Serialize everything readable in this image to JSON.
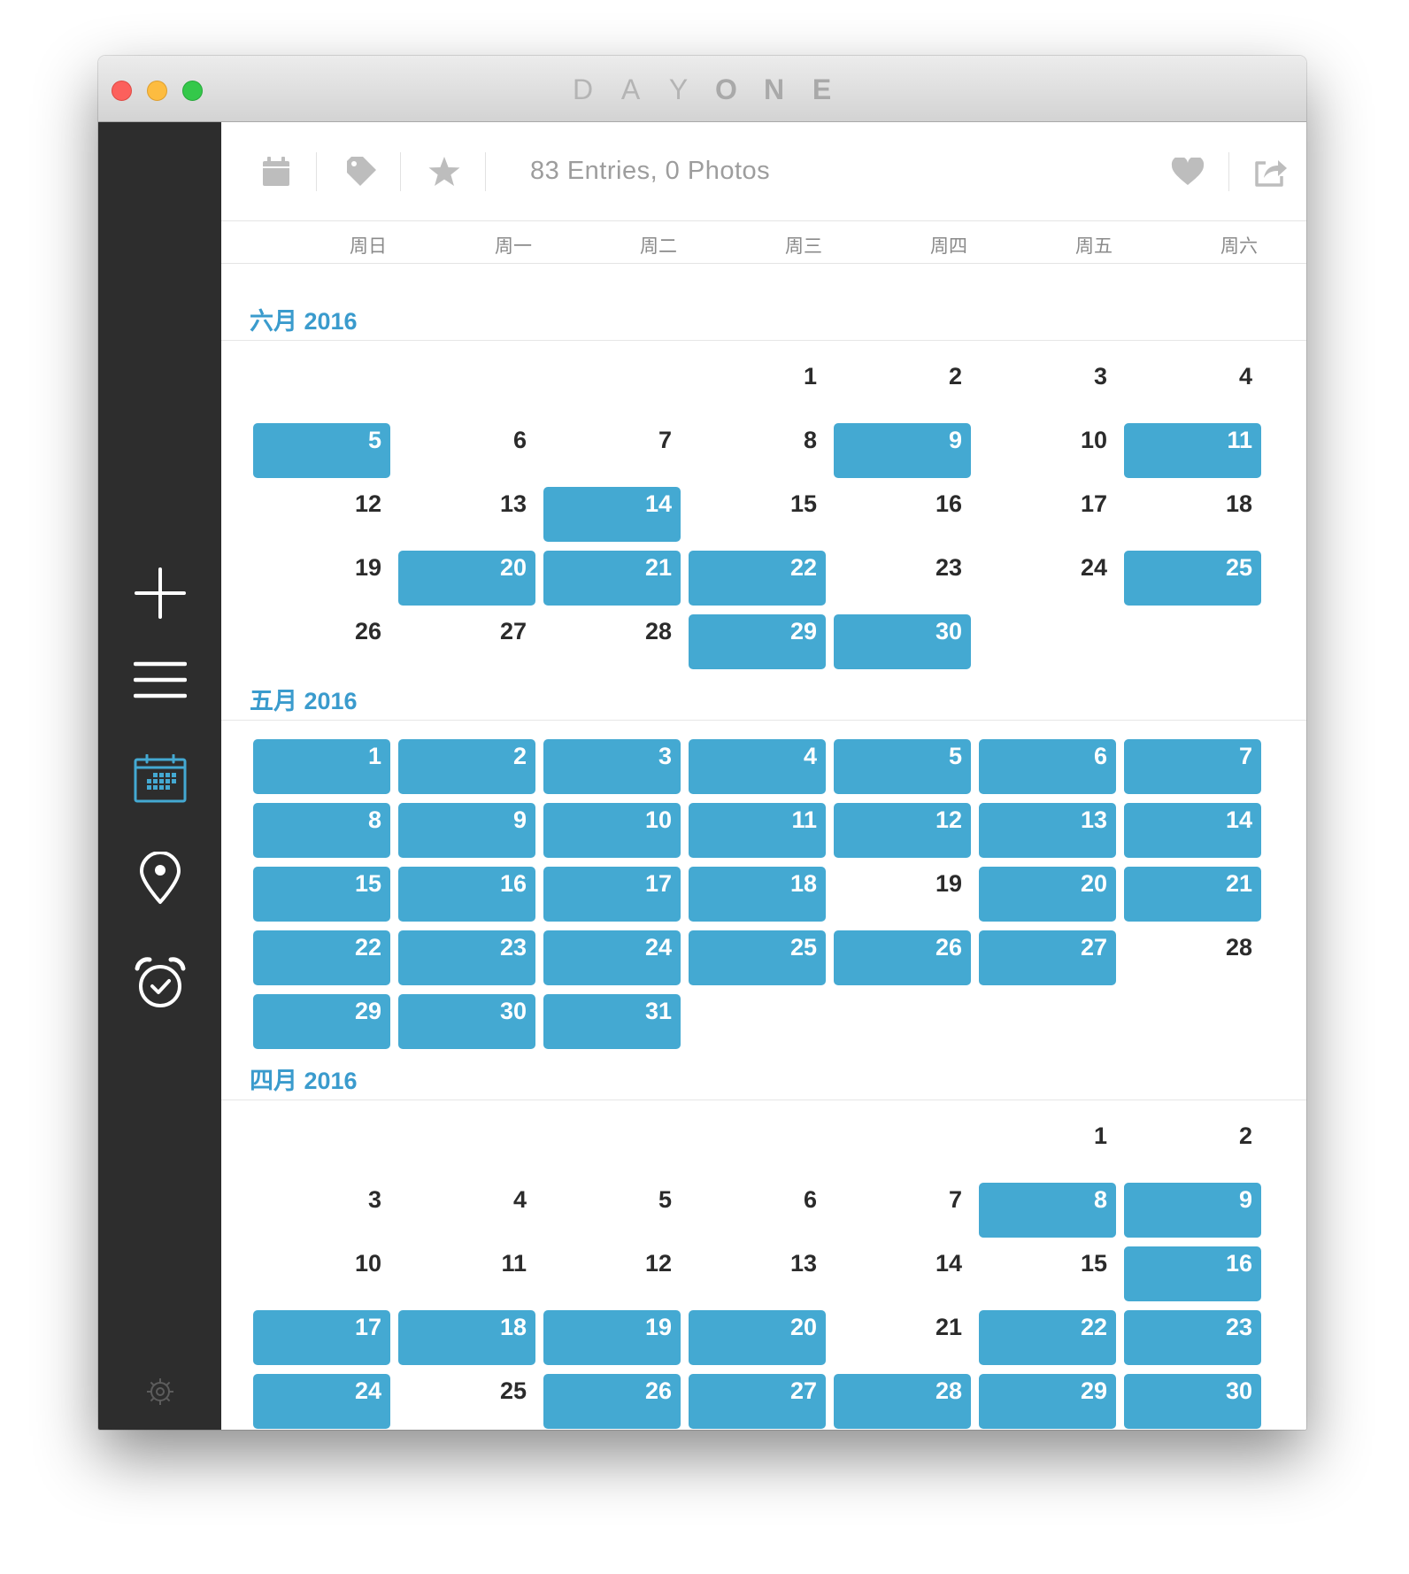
{
  "window": {
    "title_letters": [
      "D",
      "A",
      "Y",
      "O",
      "N",
      "E"
    ]
  },
  "sidebar": {
    "items": [
      {
        "name": "new-entry",
        "icon": "plus-icon"
      },
      {
        "name": "timeline",
        "icon": "list-icon"
      },
      {
        "name": "calendar",
        "icon": "calendar-icon",
        "active": true
      },
      {
        "name": "places",
        "icon": "map-pin-icon"
      },
      {
        "name": "reminders",
        "icon": "alarm-clock-icon"
      }
    ],
    "settings_icon": "gear-icon"
  },
  "toolbar": {
    "left_icons": [
      "calendar-icon",
      "tag-icon",
      "star-icon"
    ],
    "status": "83 Entries, 0 Photos",
    "right_icons": [
      "heart-icon",
      "share-icon",
      "search-icon"
    ]
  },
  "weekdays": [
    "周日",
    "周一",
    "周二",
    "周三",
    "周四",
    "周五",
    "周六"
  ],
  "months": [
    {
      "title": "六月 2016",
      "first_weekday": 3,
      "days": 30,
      "entry_days": [
        5,
        9,
        11,
        14,
        20,
        21,
        22,
        25,
        29,
        30
      ]
    },
    {
      "title": "五月 2016",
      "first_weekday": 0,
      "days": 31,
      "entry_days": [
        1,
        2,
        3,
        4,
        5,
        6,
        7,
        8,
        9,
        10,
        11,
        12,
        13,
        14,
        15,
        16,
        17,
        18,
        20,
        21,
        22,
        23,
        24,
        25,
        26,
        27,
        29,
        30,
        31
      ]
    },
    {
      "title": "四月 2016",
      "first_weekday": 5,
      "days": 30,
      "entry_days": [
        8,
        9,
        16,
        17,
        18,
        19,
        20,
        22,
        23,
        24,
        26,
        27,
        28,
        29,
        30
      ]
    }
  ],
  "colors": {
    "accent": "#44a9d2",
    "month_title": "#3a9bcd",
    "sidebar_bg": "#2d2d2d",
    "sidebar_icon": "#ffffff",
    "sidebar_active": "#44a9d2",
    "toolbar_icon": "#bdbdbd"
  }
}
